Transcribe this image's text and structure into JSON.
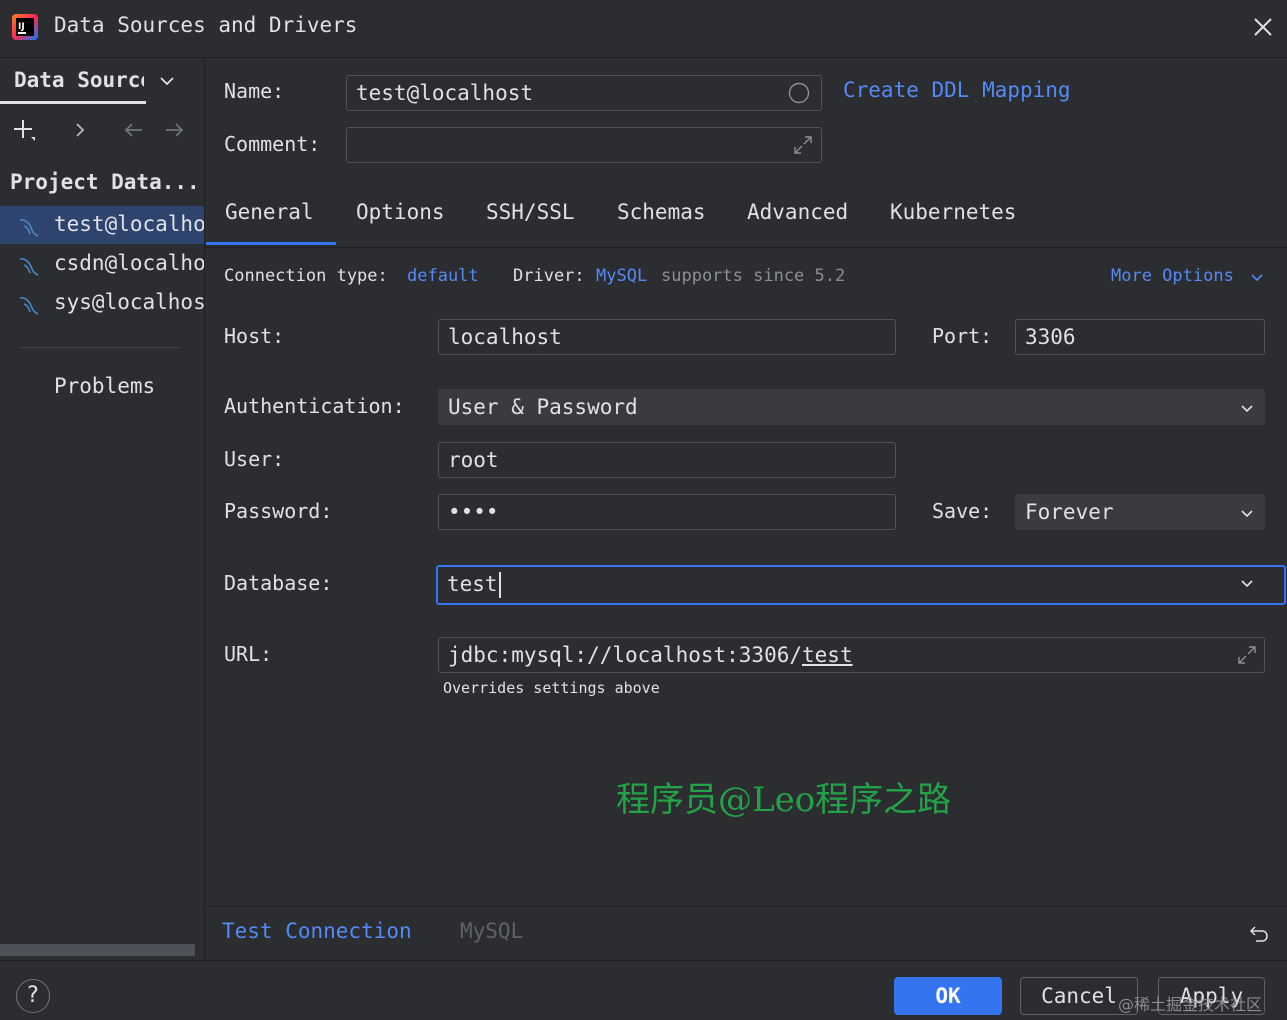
{
  "window": {
    "title": "Data Sources and Drivers",
    "icon": "intellij-app-icon",
    "close_icon": "close-icon"
  },
  "sidebar": {
    "header": "Data Sources",
    "tools": [
      "add-icon",
      "chevron-right-icon",
      "arrow-left-icon",
      "arrow-right-icon"
    ],
    "section": "Project Data...",
    "items": [
      {
        "label": "test@localhost",
        "selected": true,
        "icon": "mysql-icon"
      },
      {
        "label": "csdn@localhost",
        "selected": false,
        "icon": "mysql-icon"
      },
      {
        "label": "sys@localhost",
        "selected": false,
        "icon": "mysql-icon"
      }
    ],
    "problems": "Problems"
  },
  "form": {
    "name_label": "Name:",
    "name_value": "test@localhost",
    "comment_label": "Comment:",
    "comment_value": "",
    "ddl_link": "Create DDL Mapping"
  },
  "tabs": [
    "General",
    "Options",
    "SSH/SSL",
    "Schemas",
    "Advanced",
    "Kubernetes"
  ],
  "active_tab": "General",
  "general": {
    "conn_type_label": "Connection type:",
    "conn_type_value": "default",
    "driver_label": "Driver:",
    "driver_value": "MySQL",
    "driver_note": "supports since 5.2",
    "more_options": "More Options",
    "host_label": "Host:",
    "host_value": "localhost",
    "port_label": "Port:",
    "port_value": "3306",
    "auth_label": "Authentication:",
    "auth_value": "User & Password",
    "user_label": "User:",
    "user_value": "root",
    "password_label": "Password:",
    "password_value": "••••",
    "save_label": "Save:",
    "save_value": "Forever",
    "database_label": "Database:",
    "database_value": "test",
    "url_label": "URL:",
    "url_prefix": "jdbc:mysql://localhost:3306/",
    "url_db": "test",
    "url_note": "Overrides settings above"
  },
  "watermark": "程序员@Leo程序之路",
  "bottom": {
    "test_connection": "Test Connection",
    "driver_name": "MySQL",
    "revert_icon": "undo-icon"
  },
  "footer": {
    "help": "?",
    "ok": "OK",
    "cancel": "Cancel",
    "apply": "Apply",
    "credit": "@稀土掘金技术社区"
  },
  "colors": {
    "background": "#2b2d30",
    "accent": "#3574f0",
    "link": "#548af7",
    "selection": "#2e436e",
    "watermark": "#23a347"
  }
}
